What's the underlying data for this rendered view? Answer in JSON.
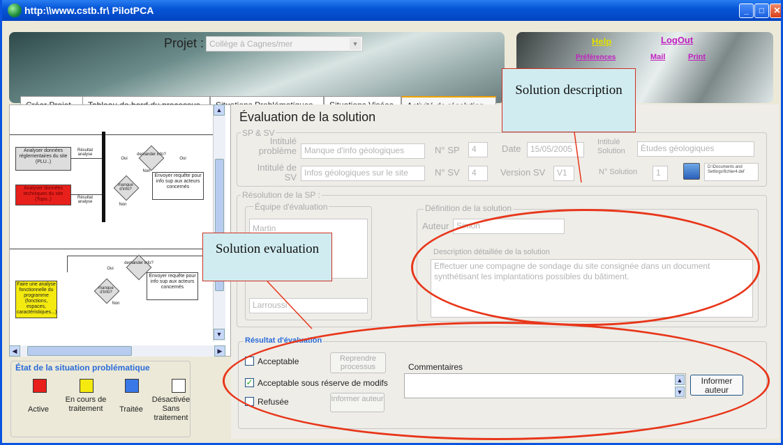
{
  "window": {
    "title": "http:\\\\www.cstb.fr\\ PilotPCA"
  },
  "header": {
    "project_label": "Projet :",
    "project_value": "Collège à Cagnes/mer",
    "help": "Help",
    "logout": "LogOut",
    "preferences": "Préférences",
    "mail": "Mail",
    "print": "Print"
  },
  "tabs": [
    "Créer Projet",
    "Tableau de bord du processus",
    "Situations Problématiques",
    "Situations Visées",
    "Activité de résolution"
  ],
  "diagram": {
    "box1": "Analyser données réglementaires du site (PLU..)",
    "box2": "Analyser données techniques du site (Topo..)",
    "box3": "Faire une analyse fonctionnelle du programme (fonctions, espaces, caractéristiques...)",
    "resultat": "Résultat analyse",
    "oui": "Oui",
    "non": "Non",
    "demande": "demander info?",
    "manque": "manque d'info?",
    "requete": "Envoyer requête pour info sup aux acteurs concernés"
  },
  "legend": {
    "title": "État de la situation problématique",
    "items": [
      {
        "label": "Active",
        "color": "#e8201c"
      },
      {
        "label": "En cours de traitement",
        "color": "#f4ea10"
      },
      {
        "label": "Traitée",
        "color": "#3a78e8"
      },
      {
        "label": "Désactivée Sans traitement",
        "color": "#ffffff"
      }
    ]
  },
  "main": {
    "title": "Évaluation de la solution",
    "spsv": {
      "legend": "SP & SV",
      "intitule_probleme_label": "Intitulé problème",
      "intitule_probleme": "Manque d'info géologiques",
      "nsp_label": "N° SP",
      "nsp": "4",
      "date_label": "Date",
      "date": "15/05/2005",
      "intitule_sv_label": "Intitulé de SV",
      "intitule_sv": "Infos géologiques sur le site",
      "nsv_label": "N° SV",
      "nsv": "4",
      "version_label": "Version SV",
      "version": "V1",
      "intitule_solution_label": "Intitulé Solution",
      "intitule_solution": "Études géologiques",
      "nsolution_label": "N° Solution",
      "nsolution": "1",
      "filepath": "D:\\Documents and Settings\\fichier4.def"
    },
    "resolution": {
      "legend": "Résolution de la SP :",
      "equipe_legend": "Équipe d'évaluation",
      "equipe_members": [
        "Martin"
      ],
      "equipe_select": "Larroussi",
      "definition_legend": "Définition de la solution",
      "auteur_label": "Auteur",
      "auteur": "Simon",
      "description_label": "Description détaillée de la solution",
      "description": "Effectuer une compagne de sondage du site consignée dans un document synthétisant les implantations possibles du bâtiment."
    },
    "resultat": {
      "legend": "Résultat d'évaluation",
      "acceptable": "Acceptable",
      "acceptable_reserve": "Acceptable  sous réserve de modifs",
      "refusee": "Refusée",
      "reprendre": "Reprendre processus",
      "informer_gray": "Informer auteur",
      "commentaires": "Commentaires",
      "informer": "Informer auteur"
    }
  },
  "annotations": {
    "solution_description": "Solution description",
    "solution_evaluation": "Solution evaluation"
  }
}
